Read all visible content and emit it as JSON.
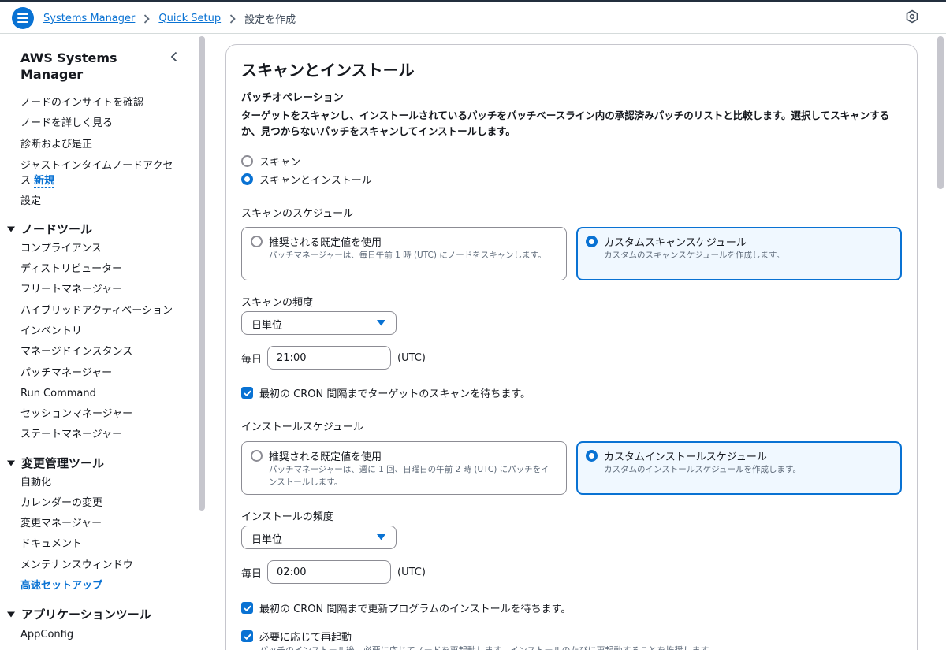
{
  "breadcrumb": {
    "items": [
      "Systems Manager",
      "Quick Setup"
    ],
    "current": "設定を作成"
  },
  "sidebar": {
    "title": "AWS Systems Manager",
    "top_items": [
      "ノードのインサイトを確認",
      "ノードを詳しく見る",
      "診断および是正",
      "ジャストインタイムノードアクセス"
    ],
    "new_badge": "新規",
    "settings": "設定",
    "sections": [
      {
        "title": "ノードツール",
        "items": [
          "コンプライアンス",
          "ディストリビューター",
          "フリートマネージャー",
          "ハイブリッドアクティベーション",
          "インベントリ",
          "マネージドインスタンス",
          "パッチマネージャー",
          "Run Command",
          "セッションマネージャー",
          "ステートマネージャー"
        ]
      },
      {
        "title": "変更管理ツール",
        "items": [
          "自動化",
          "カレンダーの変更",
          "変更マネージャー",
          "ドキュメント",
          "メンテナンスウィンドウ",
          "高速セットアップ"
        ]
      },
      {
        "title": "アプリケーションツール",
        "items": [
          "AppConfig"
        ]
      }
    ],
    "active_item": "高速セットアップ"
  },
  "panel": {
    "heading": "スキャンとインストール",
    "patch_op_label": "パッチオペレーション",
    "patch_op_desc": "ターゲットをスキャンし、インストールされているパッチをパッチベースライン内の承認済みパッチのリストと比較します。選択してスキャンするか、見つからないパッチをスキャンしてインストールします。",
    "op_options": [
      {
        "label": "スキャン",
        "checked": false
      },
      {
        "label": "スキャンとインストール",
        "checked": true
      }
    ],
    "scan_schedule": {
      "label": "スキャンのスケジュール",
      "tiles": [
        {
          "title": "推奨される既定値を使用",
          "desc": "パッチマネージャーは、毎日午前 1 時 (UTC) にノードをスキャンします。",
          "selected": false
        },
        {
          "title": "カスタムスキャンスケジュール",
          "desc": "カスタムのスキャンスケジュールを作成します。",
          "selected": true
        }
      ],
      "freq_label": "スキャンの頻度",
      "freq_value": "日単位",
      "every_label": "毎日",
      "time_value": "21:00",
      "tz": "(UTC)",
      "wait_check": "最初の CRON 間隔までターゲットのスキャンを待ちます。"
    },
    "install_schedule": {
      "label": "インストールスケジュール",
      "tiles": [
        {
          "title": "推奨される既定値を使用",
          "desc": "パッチマネージャーは、週に 1 回、日曜日の午前 2 時 (UTC) にパッチをインストールします。",
          "selected": false
        },
        {
          "title": "カスタムインストールスケジュール",
          "desc": "カスタムのインストールスケジュールを作成します。",
          "selected": true
        }
      ],
      "freq_label": "インストールの頻度",
      "freq_value": "日単位",
      "every_label": "毎日",
      "time_value": "02:00",
      "tz": "(UTC)",
      "wait_check": "最初の CRON 間隔まで更新プログラムのインストールを待ちます。"
    },
    "reboot_check": "必要に応じて再起動",
    "reboot_desc": "パッチのインストール後、必要に応じてノードを再起動します。インストールのたびに再起動することを推奨します。"
  },
  "colors": {
    "accent": "#0972d3",
    "selected_bg": "#f0f8ff",
    "border": "#8c8c94"
  }
}
